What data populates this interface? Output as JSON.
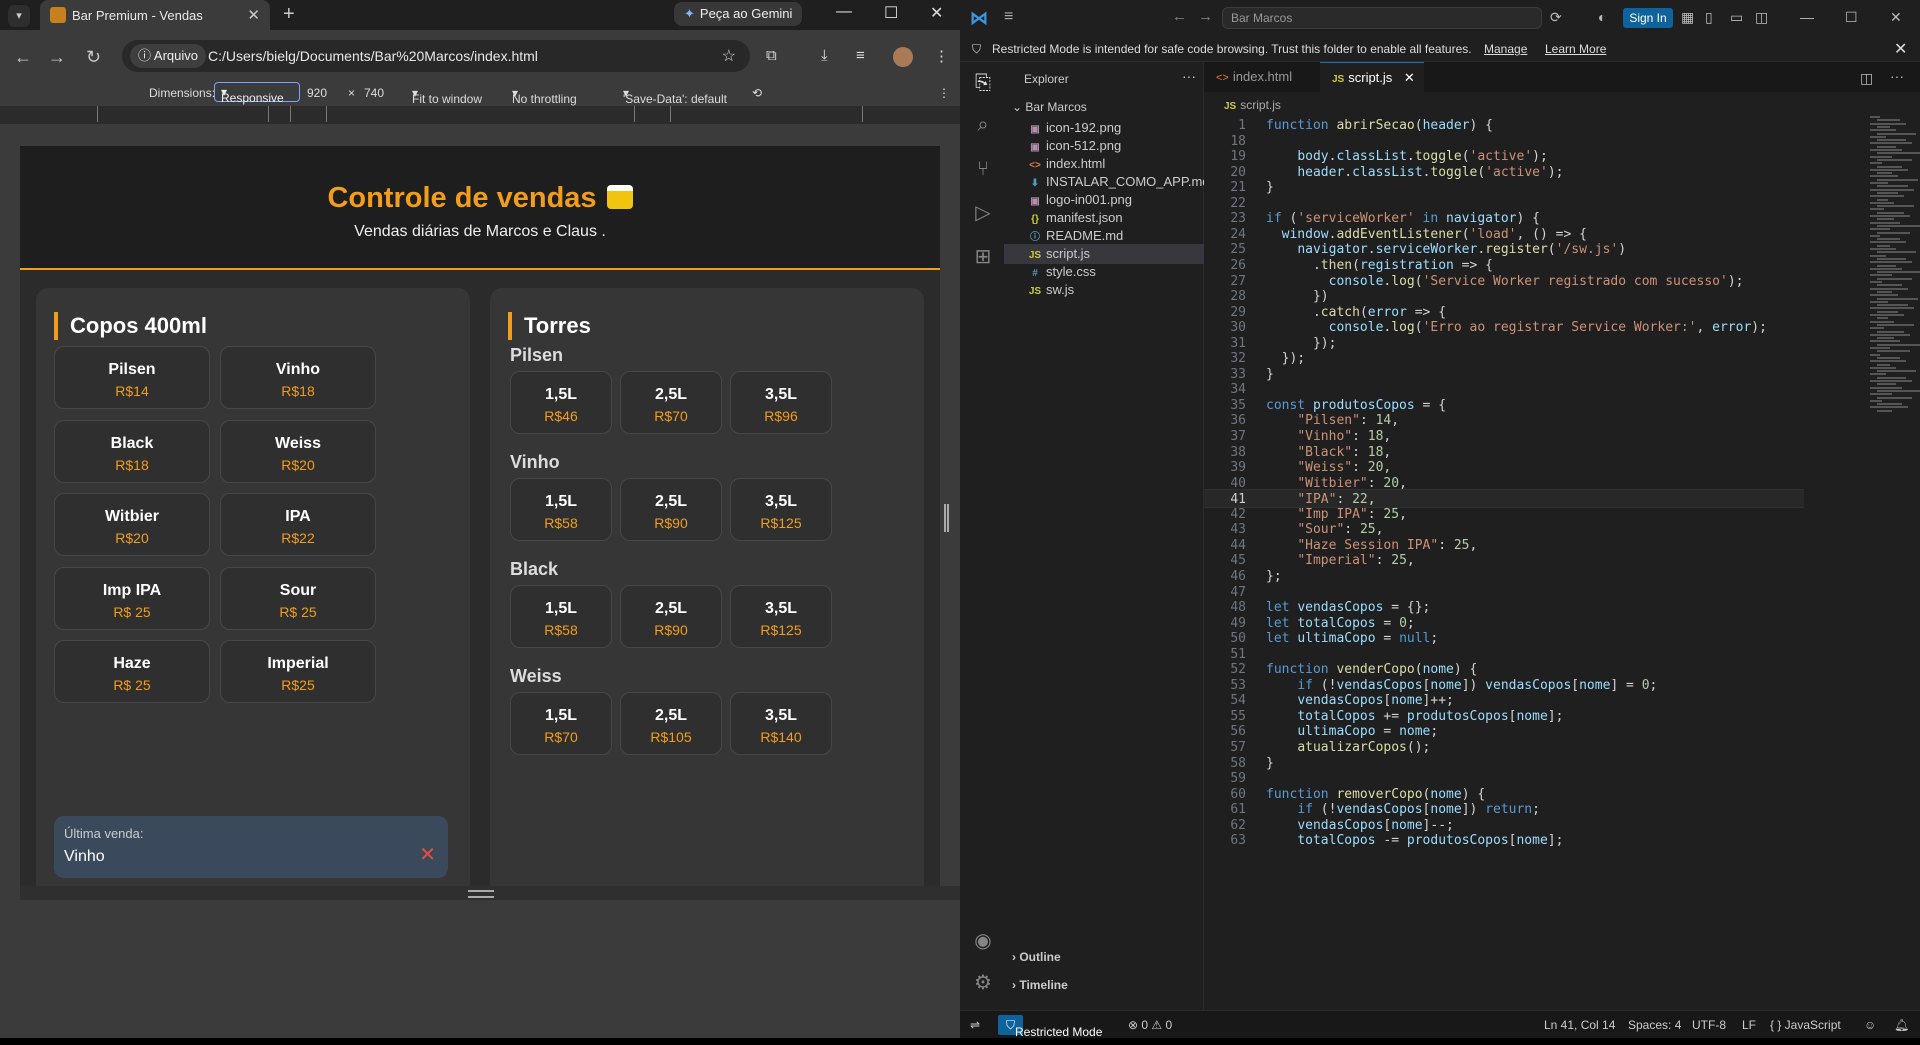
{
  "browser": {
    "tab_title": "Bar Premium - Vendas",
    "gemini_label": "Peça ao Gemini",
    "address_chip": "Arquivo",
    "url": "C:/Users/bielg/Documents/Bar%20Marcos/index.html",
    "devtools": {
      "dimensions_label": "Dimensions:",
      "mode": "Responsive",
      "width": "920",
      "times": "×",
      "height": "740",
      "zoom": "Fit to window",
      "throttling": "No throttling",
      "save_data": "'Save-Data': default"
    }
  },
  "app": {
    "title": "Controle de vendas",
    "subtitle": "Vendas diárias de Marcos e Claus .",
    "copos": {
      "title": "Copos 400ml",
      "items": [
        {
          "name": "Pilsen",
          "price": "R$14"
        },
        {
          "name": "Vinho",
          "price": "R$18"
        },
        {
          "name": "Black",
          "price": "R$18"
        },
        {
          "name": "Weiss",
          "price": "R$20"
        },
        {
          "name": "Witbier",
          "price": "R$20"
        },
        {
          "name": "IPA",
          "price": "R$22"
        },
        {
          "name": "Imp IPA",
          "price": "R$ 25"
        },
        {
          "name": "Sour",
          "price": "R$ 25"
        },
        {
          "name": "Haze",
          "price": "R$ 25"
        },
        {
          "name": "Imperial",
          "price": "R$25"
        }
      ],
      "last_sale_label": "Última venda:",
      "last_sale_value": "Vinho"
    },
    "torres": {
      "title": "Torres",
      "groups": [
        {
          "name": "Pilsen",
          "items": [
            {
              "size": "1,5L",
              "price": "R$46"
            },
            {
              "size": "2,5L",
              "price": "R$70"
            },
            {
              "size": "3,5L",
              "price": "R$96"
            }
          ]
        },
        {
          "name": "Vinho",
          "items": [
            {
              "size": "1,5L",
              "price": "R$58"
            },
            {
              "size": "2,5L",
              "price": "R$90"
            },
            {
              "size": "3,5L",
              "price": "R$125"
            }
          ]
        },
        {
          "name": "Black",
          "items": [
            {
              "size": "1,5L",
              "price": "R$58"
            },
            {
              "size": "2,5L",
              "price": "R$90"
            },
            {
              "size": "3,5L",
              "price": "R$125"
            }
          ]
        },
        {
          "name": "Weiss",
          "items": [
            {
              "size": "1,5L",
              "price": "R$70"
            },
            {
              "size": "2,5L",
              "price": "R$105"
            },
            {
              "size": "3,5L",
              "price": "R$140"
            }
          ]
        }
      ]
    }
  },
  "vscode": {
    "search_text": "Bar Marcos",
    "sign_in": "Sign In",
    "banner": {
      "message": "Restricted Mode is intended for safe code browsing. Trust this folder to enable all features.",
      "manage": "Manage",
      "learn_more": "Learn More"
    },
    "explorer": {
      "header": "Explorer",
      "folder": "Bar Marcos",
      "files": [
        {
          "name": "icon-192.png",
          "icon": "image-icon"
        },
        {
          "name": "icon-512.png",
          "icon": "image-icon"
        },
        {
          "name": "index.html",
          "icon": "html-icon"
        },
        {
          "name": "INSTALAR_COMO_APP.md",
          "icon": "markdown-icon"
        },
        {
          "name": "logo-in001.png",
          "icon": "image-icon"
        },
        {
          "name": "manifest.json",
          "icon": "json-icon"
        },
        {
          "name": "README.md",
          "icon": "info-icon"
        },
        {
          "name": "script.js",
          "icon": "js-icon"
        },
        {
          "name": "style.css",
          "icon": "css-icon"
        },
        {
          "name": "sw.js",
          "icon": "js-icon"
        }
      ],
      "outline": "Outline",
      "timeline": "Timeline"
    },
    "tabs": [
      {
        "label": "index.html"
      },
      {
        "label": "script.js"
      }
    ],
    "breadcrumb": "script.js",
    "code_lines": [
      {
        "n": "1",
        "t": "function abrirSecao(header) {"
      },
      {
        "n": "18",
        "t": ""
      },
      {
        "n": "19",
        "t": "    body.classList.toggle('active');"
      },
      {
        "n": "20",
        "t": "    header.classList.toggle('active');"
      },
      {
        "n": "21",
        "t": "}"
      },
      {
        "n": "22",
        "t": ""
      },
      {
        "n": "23",
        "t": "if ('serviceWorker' in navigator) {"
      },
      {
        "n": "24",
        "t": "  window.addEventListener('load', () => {"
      },
      {
        "n": "25",
        "t": "    navigator.serviceWorker.register('/sw.js')"
      },
      {
        "n": "26",
        "t": "      .then(registration => {"
      },
      {
        "n": "27",
        "t": "        console.log('Service Worker registrado com sucesso');"
      },
      {
        "n": "28",
        "t": "      })"
      },
      {
        "n": "29",
        "t": "      .catch(error => {"
      },
      {
        "n": "30",
        "t": "        console.log('Erro ao registrar Service Worker:', error);"
      },
      {
        "n": "31",
        "t": "      });"
      },
      {
        "n": "32",
        "t": "  });"
      },
      {
        "n": "33",
        "t": "}"
      },
      {
        "n": "34",
        "t": ""
      },
      {
        "n": "35",
        "t": "const produtosCopos = {"
      },
      {
        "n": "36",
        "t": "    \"Pilsen\": 14,"
      },
      {
        "n": "37",
        "t": "    \"Vinho\": 18,"
      },
      {
        "n": "38",
        "t": "    \"Black\": 18,"
      },
      {
        "n": "39",
        "t": "    \"Weiss\": 20,"
      },
      {
        "n": "40",
        "t": "    \"Witbier\": 20,"
      },
      {
        "n": "41",
        "t": "    \"IPA\": 22,"
      },
      {
        "n": "42",
        "t": "    \"Imp IPA\": 25,"
      },
      {
        "n": "43",
        "t": "    \"Sour\": 25,"
      },
      {
        "n": "44",
        "t": "    \"Haze Session IPA\": 25,"
      },
      {
        "n": "45",
        "t": "    \"Imperial\": 25,"
      },
      {
        "n": "46",
        "t": "};"
      },
      {
        "n": "47",
        "t": ""
      },
      {
        "n": "48",
        "t": "let vendasCopos = {};"
      },
      {
        "n": "49",
        "t": "let totalCopos = 0;"
      },
      {
        "n": "50",
        "t": "let ultimaCopo = null;"
      },
      {
        "n": "51",
        "t": ""
      },
      {
        "n": "52",
        "t": "function venderCopo(nome) {"
      },
      {
        "n": "53",
        "t": "    if (!vendasCopos[nome]) vendasCopos[nome] = 0;"
      },
      {
        "n": "54",
        "t": "    vendasCopos[nome]++;"
      },
      {
        "n": "55",
        "t": "    totalCopos += produtosCopos[nome];"
      },
      {
        "n": "56",
        "t": "    ultimaCopo = nome;"
      },
      {
        "n": "57",
        "t": "    atualizarCopos();"
      },
      {
        "n": "58",
        "t": "}"
      },
      {
        "n": "59",
        "t": ""
      },
      {
        "n": "60",
        "t": "function removerCopo(nome) {"
      },
      {
        "n": "61",
        "t": "    if (!vendasCopos[nome]) return;"
      },
      {
        "n": "62",
        "t": "    vendasCopos[nome]--;"
      },
      {
        "n": "63",
        "t": "    totalCopos -= produtosCopos[nome];"
      }
    ],
    "current_line": "41",
    "status": {
      "mode": "Restricted Mode",
      "problems": "⊗ 0 ⚠ 0",
      "position": "Ln 41, Col 14",
      "spaces": "Spaces: 4",
      "encoding": "UTF-8",
      "eol": "LF",
      "language": "{ } JavaScript"
    }
  },
  "colors": {
    "accent": "#f29d1b",
    "vs_blue": "#0e639c"
  }
}
